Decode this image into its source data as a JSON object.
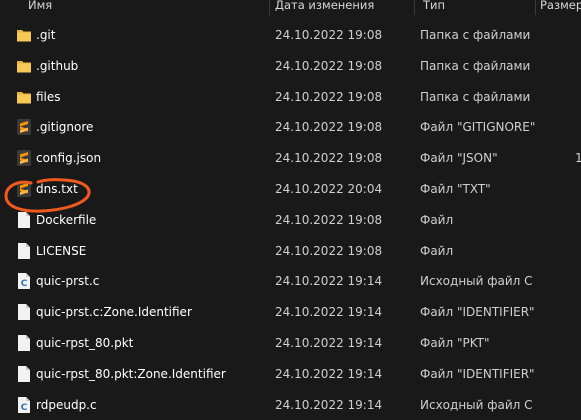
{
  "columns": {
    "name": "Имя",
    "date": "Дата изменения",
    "type": "Тип",
    "size": "Размер"
  },
  "files": [
    {
      "name": ".git",
      "date": "24.10.2022 19:08",
      "type": "Папка с файлами",
      "size": "",
      "icon": "folder-icon"
    },
    {
      "name": ".github",
      "date": "24.10.2022 19:08",
      "type": "Папка с файлами",
      "size": "",
      "icon": "folder-icon"
    },
    {
      "name": "files",
      "date": "24.10.2022 19:08",
      "type": "Папка с файлами",
      "size": "",
      "icon": "folder-icon"
    },
    {
      "name": ".gitignore",
      "date": "24.10.2022 19:08",
      "type": "Файл \"GITIGNORE\"",
      "size": "",
      "icon": "sublime-file-icon"
    },
    {
      "name": "config.json",
      "date": "24.10.2022 19:08",
      "type": "Файл \"JSON\"",
      "size": "1",
      "icon": "sublime-file-icon"
    },
    {
      "name": "dns.txt",
      "date": "24.10.2022 20:04",
      "type": "Файл \"TXT\"",
      "size": "",
      "icon": "sublime-file-icon"
    },
    {
      "name": "Dockerfile",
      "date": "24.10.2022 19:08",
      "type": "Файл",
      "size": "",
      "icon": "blank-file-icon"
    },
    {
      "name": "LICENSE",
      "date": "24.10.2022 19:08",
      "type": "Файл",
      "size": "",
      "icon": "blank-file-icon"
    },
    {
      "name": "quic-prst.c",
      "date": "24.10.2022 19:14",
      "type": "Исходный файл C",
      "size": "",
      "icon": "c-source-file-icon"
    },
    {
      "name": "quic-prst.c꞉Zone.Identifier",
      "date": "24.10.2022 19:14",
      "type": "Файл \"IDENTIFIER\"",
      "size": "",
      "icon": "blank-file-icon"
    },
    {
      "name": "quic-rpst_80.pkt",
      "date": "24.10.2022 19:14",
      "type": "Файл \"PKT\"",
      "size": "",
      "icon": "blank-file-icon"
    },
    {
      "name": "quic-rpst_80.pkt꞉Zone.Identifier",
      "date": "24.10.2022 19:14",
      "type": "Файл \"IDENTIFIER\"",
      "size": "",
      "icon": "blank-file-icon"
    },
    {
      "name": "rdpeudp.c",
      "date": "24.10.2022 19:14",
      "type": "Исходный файл C",
      "size": "",
      "icon": "c-source-file-icon"
    }
  ],
  "colors": {
    "background": "#191919",
    "folder": "#f2c14e",
    "sublime": "#ff9800",
    "annotation": "#f05a1e"
  }
}
